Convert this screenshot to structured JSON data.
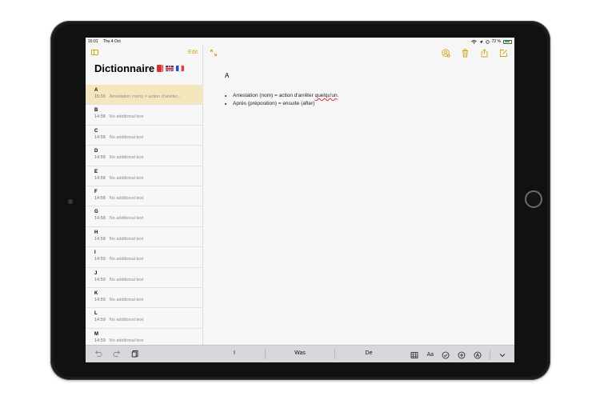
{
  "status_bar": {
    "time": "15:01",
    "date": "Thu 4 Oct",
    "battery_percent": "72 %",
    "battery_level": 0.72
  },
  "sidebar": {
    "edit_label": "Edit",
    "folder_title": "Dictionnaire",
    "folder_emoji": [
      "red-book",
      "uk-flag",
      "france-flag"
    ],
    "notes": [
      {
        "title": "A",
        "time": "15:01",
        "preview": "Arrestation (nom) = action d'arrêter...",
        "selected": true
      },
      {
        "title": "B",
        "time": "14:58",
        "preview": "No additional text"
      },
      {
        "title": "C",
        "time": "14:58",
        "preview": "No additional text"
      },
      {
        "title": "D",
        "time": "14:58",
        "preview": "No additional text"
      },
      {
        "title": "E",
        "time": "14:58",
        "preview": "No additional text"
      },
      {
        "title": "F",
        "time": "14:58",
        "preview": "No additional text"
      },
      {
        "title": "G",
        "time": "14:58",
        "preview": "No additional text"
      },
      {
        "title": "H",
        "time": "14:58",
        "preview": "No additional text"
      },
      {
        "title": "I",
        "time": "14:59",
        "preview": "No additional text"
      },
      {
        "title": "J",
        "time": "14:59",
        "preview": "No additional text"
      },
      {
        "title": "K",
        "time": "14:59",
        "preview": "No additional text"
      },
      {
        "title": "L",
        "time": "14:59",
        "preview": "No additional text"
      },
      {
        "title": "M",
        "time": "14:59",
        "preview": "No additional text"
      }
    ]
  },
  "editor": {
    "heading": "A",
    "bullets": [
      {
        "before": "Arrestation (nom) = action d'arrêter ",
        "misspelled": "quelqu'un",
        "after": "."
      },
      {
        "before": "Après (préposition) = ensuite (after)",
        "misspelled": "",
        "after": ""
      }
    ],
    "toolbar_icons": [
      "add-person-icon",
      "trash-icon",
      "share-icon",
      "compose-icon"
    ]
  },
  "shortcut_bar": {
    "suggestions": [
      "I",
      "Was",
      "De"
    ],
    "format_label": "Aa",
    "icons": [
      "undo-icon",
      "redo-icon",
      "paste-icon",
      "table-icon",
      "checklist-icon",
      "plus-circle-icon",
      "markup-icon",
      "hide-keyboard-icon"
    ]
  },
  "colors": {
    "accent": "#d6a413",
    "selected_row": "#f5e7bd",
    "keyboard_bar": "#d6d8dd"
  }
}
